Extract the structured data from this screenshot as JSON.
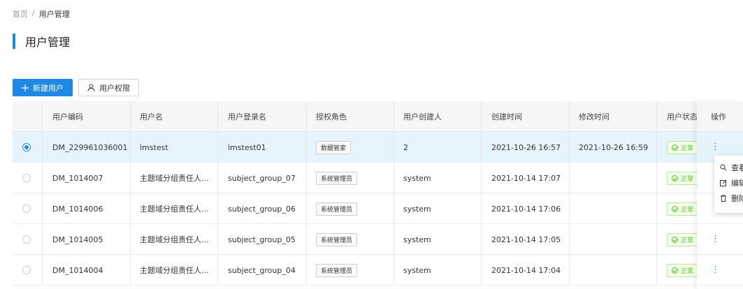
{
  "breadcrumb": {
    "home": "首页",
    "separator": "/",
    "current": "用户管理"
  },
  "page_title": "用户管理",
  "toolbar": {
    "new_user": "新建用户",
    "permissions": "用户权限"
  },
  "table": {
    "headers": [
      "用户编码",
      "用户名",
      "用户登录名",
      "授权角色",
      "用户创建人",
      "创建时间",
      "修改时间",
      "用户状态",
      "操作"
    ],
    "rows": [
      {
        "selected": true,
        "code": "DM_229961036001",
        "name": "lmstest",
        "login": "lmstest01",
        "role": "数据管家",
        "creator": "2",
        "created": "2021-10-26 16:57",
        "modified": "2021-10-26 16:59",
        "status": "正常"
      },
      {
        "selected": false,
        "code": "DM_1014007",
        "name": "主题域分组责任人...",
        "login": "subject_group_07",
        "role": "系统管理员",
        "creator": "system",
        "created": "2021-10-14 17:07",
        "modified": "",
        "status": "正常"
      },
      {
        "selected": false,
        "code": "DM_1014006",
        "name": "主题域分组责任人...",
        "login": "subject_group_06",
        "role": "系统管理员",
        "creator": "system",
        "created": "2021-10-14 17:06",
        "modified": "",
        "status": "正常"
      },
      {
        "selected": false,
        "code": "DM_1014005",
        "name": "主题域分组责任人...",
        "login": "subject_group_05",
        "role": "系统管理员",
        "creator": "system",
        "created": "2021-10-14 17:05",
        "modified": "",
        "status": "正常"
      },
      {
        "selected": false,
        "code": "DM_1014004",
        "name": "主题域分组责任人...",
        "login": "subject_group_04",
        "role": "系统管理员",
        "creator": "system",
        "created": "2021-10-14 17:04",
        "modified": "",
        "status": "正常"
      }
    ]
  },
  "dropdown": {
    "view": "查看",
    "edit": "编辑",
    "delete": "删除"
  },
  "colors": {
    "accent": "#1e88e5",
    "selected_row": "#e6f4fd",
    "status_green": "#52c41a"
  }
}
